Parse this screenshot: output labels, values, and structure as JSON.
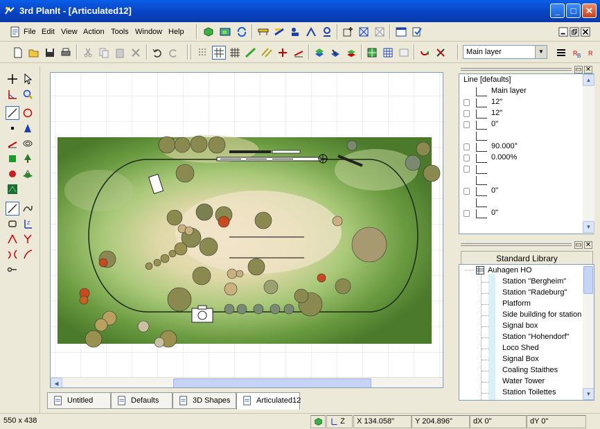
{
  "window": {
    "title": "3rd PlanIt - [Articulated12]"
  },
  "menu": [
    "File",
    "Edit",
    "View",
    "Action",
    "Tools",
    "Window",
    "Help"
  ],
  "layer_select": {
    "value": "Main layer"
  },
  "properties": {
    "header": "Line [defaults]",
    "rows": [
      {
        "icon": "layers-icon",
        "value": "Main layer",
        "lock": false
      },
      {
        "icon": "width-icon",
        "value": "12\"",
        "lock": true
      },
      {
        "icon": "dx-icon",
        "value": "12\"",
        "lock": true
      },
      {
        "icon": "dy-icon",
        "value": "0\"",
        "lock": true
      },
      {
        "icon": "angle-icon",
        "value": "",
        "lock": false
      },
      {
        "icon": "rotation-icon",
        "value": "90.000°",
        "lock": true
      },
      {
        "icon": "grade-icon",
        "value": "0.000%",
        "lock": true
      },
      {
        "icon": "z-icon",
        "value": "",
        "lock": true
      },
      {
        "icon": "z-icon",
        "value": "",
        "lock": false
      },
      {
        "icon": "z-icon",
        "value": "0\"",
        "lock": true
      },
      {
        "icon": "z-icon",
        "value": "",
        "lock": false
      },
      {
        "icon": "z-icon",
        "value": "0\"",
        "lock": true
      }
    ]
  },
  "library": {
    "header": "Standard Library",
    "group": "Auhagen HO",
    "items": [
      "Station \"Bergheim\"",
      "Station \"Radeburg\"",
      "Platform",
      "Side building for station '",
      "Signal box",
      "Station \"Hohendorf\"",
      "Loco Shed",
      "Signal Box",
      "Coaling Staithes",
      "Water Tower",
      "Station Toilettes"
    ]
  },
  "tabs": [
    {
      "label": "Untitled",
      "active": false
    },
    {
      "label": "Defaults",
      "active": false
    },
    {
      "label": "3D Shapes",
      "active": false
    },
    {
      "label": "Articulated12",
      "active": true
    }
  ],
  "status": {
    "size": "550 x 438",
    "z": "Z",
    "x": "X 134.058\"",
    "y": "Y 204.896\"",
    "dx": "dX 0\"",
    "dy": "dY 0\""
  },
  "colors": {
    "terrain": "#6a9a40",
    "title_bar": "#0a5ee8",
    "track": "#1a2a18"
  }
}
